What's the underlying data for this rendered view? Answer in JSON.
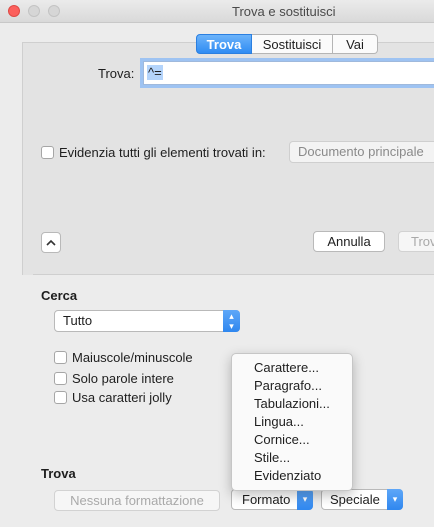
{
  "window": {
    "title": "Trova e sostituisci"
  },
  "tabs": [
    {
      "label": "Trova",
      "active": true
    },
    {
      "label": "Sostituisci",
      "active": false
    },
    {
      "label": "Vai",
      "active": false
    }
  ],
  "find": {
    "label": "Trova:",
    "value": "^="
  },
  "highlight": {
    "label": "Evidenzia tutti gli elementi trovati in:",
    "checked": false,
    "target": "Documento principale"
  },
  "actions": {
    "collapse_icon": "chevron-up-icon",
    "cancel_label": "Annulla",
    "find_next_label": "Trov"
  },
  "search": {
    "title": "Cerca",
    "scope": "Tutto",
    "options": [
      {
        "label": "Maiuscole/minuscole",
        "checked": false
      },
      {
        "label": "Solo parole intere",
        "checked": false
      },
      {
        "label": "Usa caratteri jolly",
        "checked": false
      }
    ]
  },
  "format_menu": {
    "items": [
      "Carattere...",
      "Paragrafo...",
      "Tabulazioni...",
      "Lingua...",
      "Cornice...",
      "Stile...",
      "Evidenziato"
    ]
  },
  "find_section": {
    "title": "Trova",
    "no_format_label": "Nessuna formattazione",
    "format_label": "Formato",
    "special_label": "Speciale"
  },
  "colors": {
    "accent": "#2f8cf3",
    "close": "#fc605c"
  }
}
